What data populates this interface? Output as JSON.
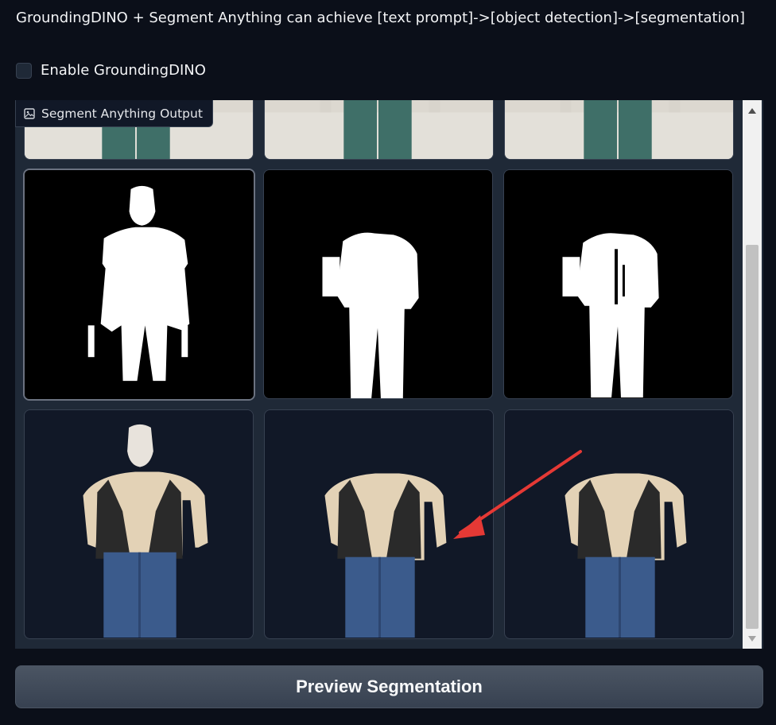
{
  "description": "GroundingDINO + Segment Anything can achieve [text prompt]->[object detection]->[segmentation]",
  "enable_checkbox": {
    "label": "Enable GroundingDINO",
    "checked": false
  },
  "gallery": {
    "label": "Segment Anything Output",
    "label_icon": "image-icon",
    "rows": [
      {
        "kind": "original-photo-partial",
        "count": 3
      },
      {
        "kind": "mask",
        "count": 3,
        "selected_index": 0
      },
      {
        "kind": "cutout",
        "count": 3
      }
    ]
  },
  "preview_button": {
    "label": "Preview Segmentation"
  },
  "colors": {
    "background": "#0b0f19",
    "panel": "#1f2937",
    "button": "#4b5563",
    "arrow": "#e53935"
  }
}
